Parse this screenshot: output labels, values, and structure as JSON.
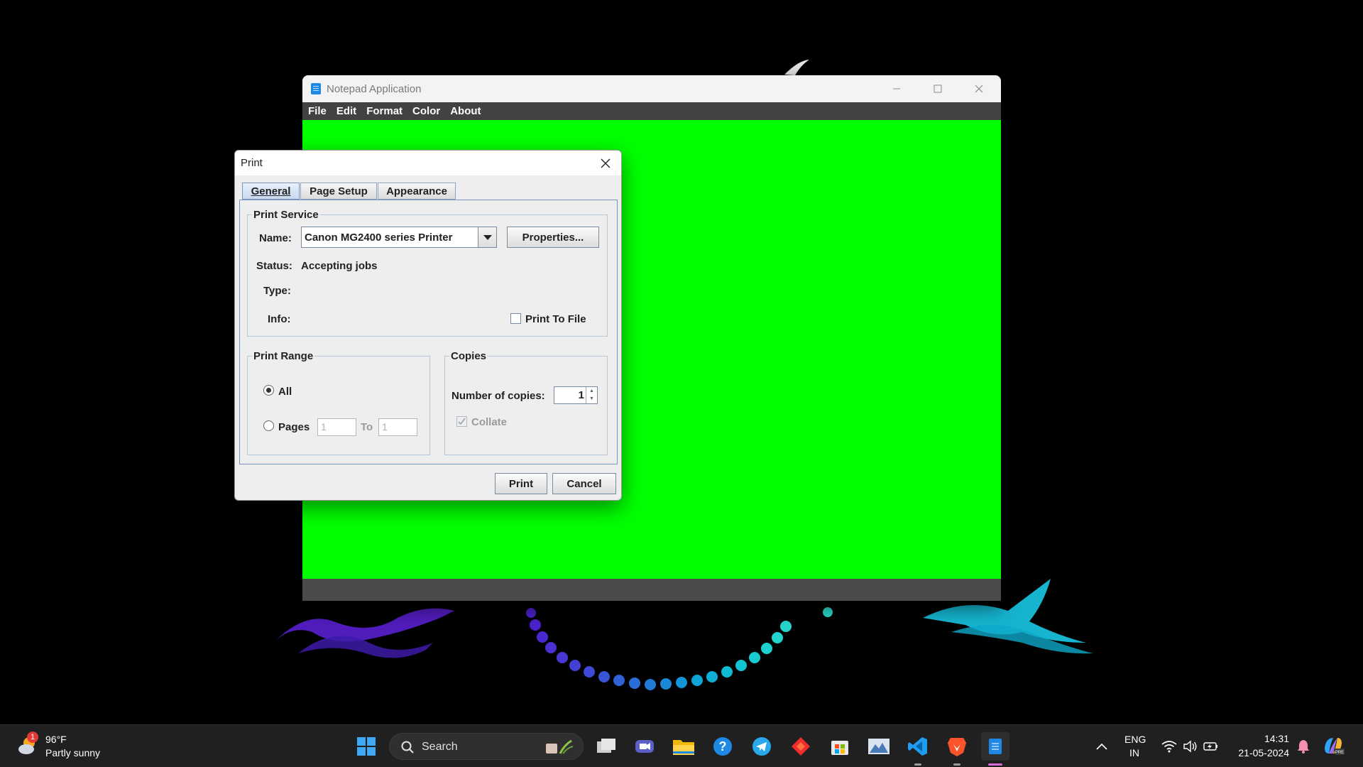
{
  "notepad": {
    "title": "Notepad Application",
    "menu": [
      "File",
      "Edit",
      "Format",
      "Color",
      "About"
    ],
    "background_color": "#00ff00"
  },
  "print_dialog": {
    "title": "Print",
    "tabs": [
      "General",
      "Page Setup",
      "Appearance"
    ],
    "active_tab": "General",
    "print_service": {
      "group_title": "Print Service",
      "name_label": "Name:",
      "printer_name": "Canon MG2400 series Printer",
      "properties_button": "Properties...",
      "status_label": "Status:",
      "status_value": "Accepting jobs",
      "type_label": "Type:",
      "info_label": "Info:",
      "print_to_file_label": "Print To File",
      "print_to_file_checked": false
    },
    "print_range": {
      "group_title": "Print Range",
      "all_label": "All",
      "all_selected": true,
      "pages_label": "Pages",
      "from_value": "1",
      "to_label": "To",
      "to_value": "1"
    },
    "copies": {
      "group_title": "Copies",
      "number_label": "Number of copies:",
      "number_value": "1",
      "collate_label": "Collate",
      "collate_checked": true
    },
    "buttons": {
      "print": "Print",
      "cancel": "Cancel"
    }
  },
  "taskbar": {
    "weather_temp": "96°F",
    "weather_desc": "Partly sunny",
    "weather_badge": "1",
    "search_placeholder": "Search",
    "language_line1": "ENG",
    "language_line2": "IN",
    "time": "14:31",
    "date": "21-05-2024",
    "pinned_icons": [
      "start-icon",
      "search-icon",
      "task-view-icon",
      "meet-icon",
      "help-icon",
      "file-explorer-icon",
      "telegram-icon",
      "anydesk-icon",
      "store-icon",
      "photos-icon",
      "vscode-icon",
      "brave-icon",
      "notepad-java-icon"
    ]
  }
}
